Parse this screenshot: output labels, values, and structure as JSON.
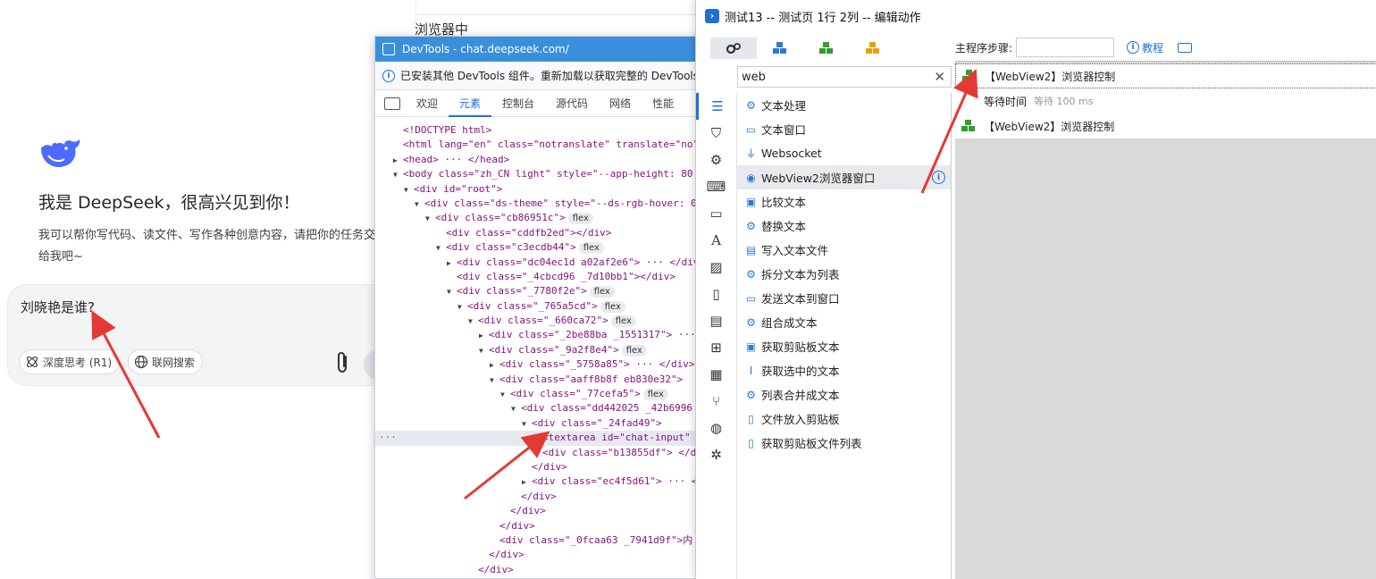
{
  "chat": {
    "behind_text": "浏览器中",
    "greeting": "我是 DeepSeek，很高兴见到你！",
    "subtitle": "我可以帮你写代码、读文件、写作各种创意内容，请把你的任务交给我吧~",
    "input_value": "刘晓艳是谁?",
    "chip_think": "深度思考 (R1)",
    "chip_search": "联网搜索"
  },
  "devtools": {
    "title": "DevTools - chat.deepseek.com/",
    "info": "已安装其他 DevTools 组件。重新加载以获取完整的 DevTools 功能",
    "tabs": [
      "欢迎",
      "元素",
      "控制台",
      "源代码",
      "网络",
      "性能"
    ],
    "active_tab": "元素",
    "tree": [
      {
        "indent": 0,
        "tri": "",
        "text": "<!DOCTYPE html>",
        "badge": ""
      },
      {
        "indent": 0,
        "tri": "",
        "text": "<html lang=\"en\" class=\"notranslate\" translate=\"no\">",
        "badge": ""
      },
      {
        "indent": 0,
        "tri": "▶",
        "text": "<head> ··· </head>",
        "badge": ""
      },
      {
        "indent": 0,
        "tri": "▼",
        "text": "<body class=\"zh_CN light\" style=\"--app-height: 80",
        "badge": ""
      },
      {
        "indent": 1,
        "tri": "▼",
        "text": "<div id=\"root\">",
        "badge": ""
      },
      {
        "indent": 2,
        "tri": "▼",
        "text": "<div class=\"ds-theme\" style=\"--ds-rgb-hover: 0",
        "badge": ""
      },
      {
        "indent": 3,
        "tri": "▼",
        "text": "<div class=\"cb86951c\">",
        "badge": "flex"
      },
      {
        "indent": 4,
        "tri": "",
        "text": "<div class=\"cddfb2ed\"></div>",
        "badge": ""
      },
      {
        "indent": 4,
        "tri": "▼",
        "text": "<div class=\"c3ecdb44\">",
        "badge": "flex"
      },
      {
        "indent": 5,
        "tri": "▶",
        "text": "<div class=\"dc04ec1d a02af2e6\"> ··· </div>",
        "badge": ""
      },
      {
        "indent": 5,
        "tri": "",
        "text": "<div class=\"_4cbcd96 _7d10bb1\"></div>",
        "badge": ""
      },
      {
        "indent": 5,
        "tri": "▼",
        "text": "<div class=\"_7780f2e\">",
        "badge": "flex"
      },
      {
        "indent": 6,
        "tri": "▼",
        "text": "<div class=\"_765a5cd\">",
        "badge": "flex"
      },
      {
        "indent": 7,
        "tri": "▼",
        "text": "<div class=\"_660ca72\">",
        "badge": "flex"
      },
      {
        "indent": 8,
        "tri": "▶",
        "text": "<div class=\"_2be88ba _1551317\"> ··· </",
        "badge": ""
      },
      {
        "indent": 8,
        "tri": "▼",
        "text": "<div class=\"_9a2f8e4\">",
        "badge": "flex"
      },
      {
        "indent": 9,
        "tri": "▶",
        "text": "<div class=\"_5758a85\"> ··· </div>",
        "badge": ""
      },
      {
        "indent": 9,
        "tri": "▼",
        "text": "<div class=\"aaff8b8f eb830e32\">",
        "badge": ""
      },
      {
        "indent": 10,
        "tri": "▼",
        "text": "<div class=\"_77cefa5\">",
        "badge": "flex"
      },
      {
        "indent": 11,
        "tri": "▼",
        "text": "<div class=\"dd442025 _42b6996",
        "badge": ""
      },
      {
        "indent": 12,
        "tri": "▼",
        "text": "<div class=\"_24fad49\">",
        "badge": ""
      },
      {
        "indent": 13,
        "tri": "",
        "text": "<textarea id=\"chat-input\"",
        "badge": "",
        "selected": true
      },
      {
        "indent": 13,
        "tri": "",
        "text": "<div class=\"b13855df\"> </d",
        "badge": ""
      },
      {
        "indent": 12,
        "tri": "",
        "text": "</div>",
        "badge": ""
      },
      {
        "indent": 12,
        "tri": "▶",
        "text": "<div class=\"ec4f5d61\"> ··· </d",
        "badge": ""
      },
      {
        "indent": 11,
        "tri": "",
        "text": "</div>",
        "badge": ""
      },
      {
        "indent": 10,
        "tri": "",
        "text": "</div>",
        "badge": ""
      },
      {
        "indent": 9,
        "tri": "",
        "text": "</div>",
        "badge": ""
      },
      {
        "indent": 9,
        "tri": "",
        "text": "<div class=\"_0fcaa63 _7941d9f\">内",
        "badge": ""
      },
      {
        "indent": 8,
        "tri": "",
        "text": "</div>",
        "badge": ""
      },
      {
        "indent": 7,
        "tri": "",
        "text": "</div>",
        "badge": ""
      }
    ]
  },
  "editor": {
    "title": "测试13 -- 测试页 1行 2列 -- 编辑动作",
    "steps_label": "主程序步骤:",
    "tutorial": "教程",
    "search_value": "web",
    "items": [
      {
        "icon": "gear",
        "text": "文本处理"
      },
      {
        "icon": "window",
        "text": "文本窗口"
      },
      {
        "icon": "plug",
        "text": "Websocket"
      },
      {
        "icon": "edge",
        "text": "WebView2浏览器窗口",
        "hover": true
      },
      {
        "icon": "box",
        "text": "比较文本"
      },
      {
        "icon": "gear",
        "text": "替换文本"
      },
      {
        "icon": "doc",
        "text": "写入文本文件"
      },
      {
        "icon": "gear",
        "text": "拆分文本为列表"
      },
      {
        "icon": "chat",
        "text": "发送文本到窗口"
      },
      {
        "icon": "gear",
        "text": "组合成文本"
      },
      {
        "icon": "box",
        "text": "获取剪贴板文本"
      },
      {
        "icon": "cursor",
        "text": "获取选中的文本"
      },
      {
        "icon": "gear",
        "text": "列表合并成文本"
      },
      {
        "icon": "clip",
        "text": "文件放入剪贴板"
      },
      {
        "icon": "clip",
        "text": "获取剪贴板文件列表"
      }
    ],
    "steps": [
      {
        "text": "【WebView2】浏览器控制",
        "note": ""
      },
      {
        "text": "等待时间",
        "note": "等待 100 ms"
      },
      {
        "text": "【WebView2】浏览器控制",
        "note": ""
      }
    ]
  },
  "colors": {
    "devtools_title": "#3a8fdd",
    "accent_blue": "#1f6fd6",
    "deepseek_blue": "#4d6bfe",
    "arrow_red": "#e53935"
  }
}
